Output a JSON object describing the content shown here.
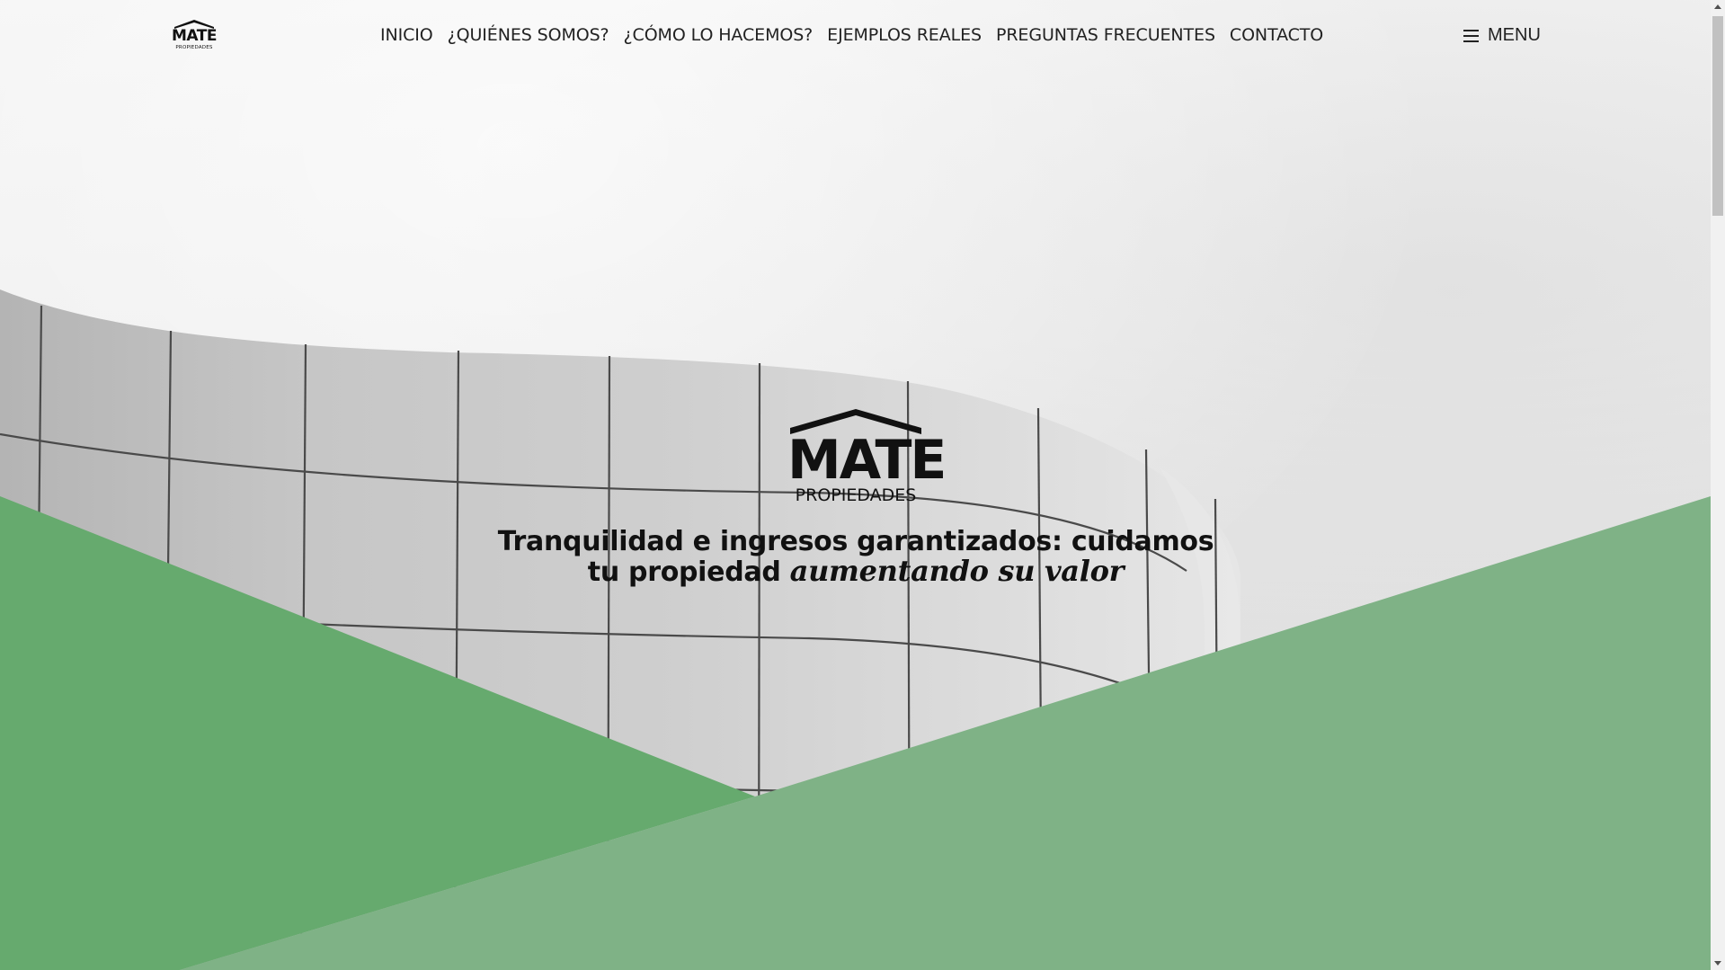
{
  "brand": {
    "name": "MATE",
    "tagline_word": "PROPIEDADES"
  },
  "nav": {
    "links": [
      "INICIO",
      "¿QUIÉNES SOMOS?",
      "¿CÓMO LO HACEMOS?",
      "EJEMPLOS REALES",
      "PREGUNTAS FRECUENTES",
      "CONTACTO"
    ],
    "menu_label": "MENU",
    "menu_icon": "hamburger-icon"
  },
  "hero": {
    "headline_bold": "Tranquilidad e ingresos garantizados:",
    "headline_regular": " cuidamos tu propiedad ",
    "headline_italic": "aumentando su valor"
  },
  "colors": {
    "green_dark": "#66aa6e",
    "green_light": "#7fb286",
    "text": "#111111"
  },
  "scrollbar": {
    "up_icon": "arrow-up-icon",
    "down_icon": "arrow-down-icon"
  }
}
